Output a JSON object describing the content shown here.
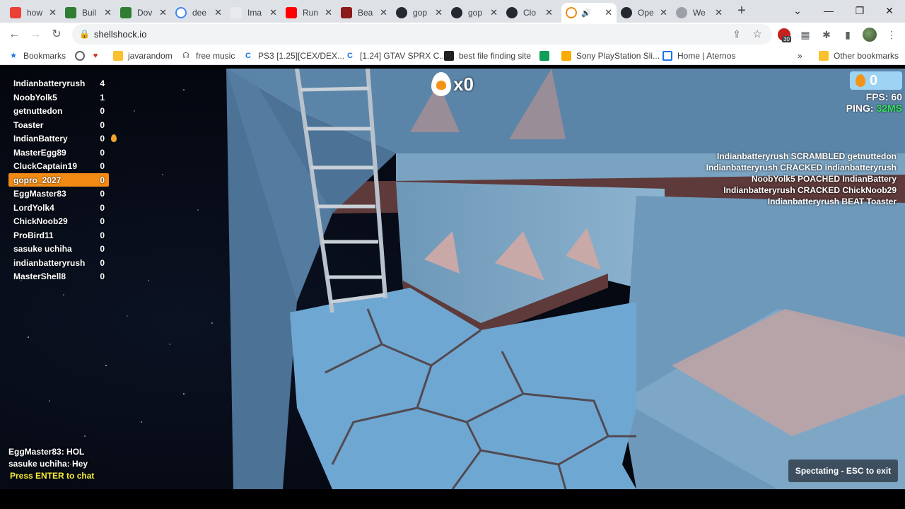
{
  "browser": {
    "tabs": [
      {
        "title": "how",
        "color": "#e94235"
      },
      {
        "title": "Buil",
        "color": "#2e7d32"
      },
      {
        "title": "Dov",
        "color": "#2e7d32"
      },
      {
        "title": "dee",
        "color": "#4285f4"
      },
      {
        "title": "Ima",
        "color": "#5f6368"
      },
      {
        "title": "Run",
        "color": "#ff0000"
      },
      {
        "title": "Bea",
        "color": "#8b1a1a"
      },
      {
        "title": "gop",
        "color": "#24292f"
      },
      {
        "title": "gop",
        "color": "#24292f"
      },
      {
        "title": "Clo",
        "color": "#24292f"
      },
      {
        "title": "",
        "color": "#f28a14"
      },
      {
        "title": "Ope",
        "color": "#24292f"
      },
      {
        "title": "We",
        "color": "#5f6368"
      }
    ],
    "url": "shellshock.io",
    "extension_badge": "30"
  },
  "bookmarks": {
    "items": [
      {
        "label": "Bookmarks",
        "icon": "star-icon"
      },
      {
        "label": "",
        "icon": "globe-icon"
      },
      {
        "label": "",
        "icon": "heart-icon"
      },
      {
        "label": "javarandom",
        "icon": "folder-icon"
      },
      {
        "label": "free music",
        "icon": "headphones-icon"
      },
      {
        "label": "PS3 [1.25][CEX/DEX...",
        "icon": "c-icon"
      },
      {
        "label": "[1.24] GTAV SPRX C...",
        "icon": "c-icon"
      },
      {
        "label": "best file finding site",
        "icon": "bus-icon"
      },
      {
        "label": "",
        "icon": "app-icon"
      },
      {
        "label": "Sony PlayStation Sli...",
        "icon": "shop-icon"
      },
      {
        "label": "Home | Aternos",
        "icon": "grid-icon"
      }
    ],
    "overflow": "»",
    "other": "Other bookmarks"
  },
  "game": {
    "scoreboard": [
      {
        "name": "Indianbatteryrush",
        "score": "4"
      },
      {
        "name": "NoobYolk5",
        "score": "1"
      },
      {
        "name": "getnuttedon",
        "score": "0"
      },
      {
        "name": "Toaster",
        "score": "0"
      },
      {
        "name": "IndianBattery",
        "score": "0"
      },
      {
        "name": "MasterEgg89",
        "score": "0"
      },
      {
        "name": "CluckCaptain19",
        "score": "0"
      },
      {
        "name": "gopro_2027",
        "score": "0"
      },
      {
        "name": "EggMaster83",
        "score": "0"
      },
      {
        "name": "LordYolk4",
        "score": "0"
      },
      {
        "name": "ChickNoob29",
        "score": "0"
      },
      {
        "name": "ProBird11",
        "score": "0"
      },
      {
        "name": "sasuke uchiha",
        "score": "0"
      },
      {
        "name": "indianbatteryrush",
        "score": "0"
      },
      {
        "name": "MasterShell8",
        "score": "0"
      }
    ],
    "kill_count": "x0",
    "eggs": "0",
    "fps_label": "FPS: 60",
    "ping_label": "PING: ",
    "ping_value": "32MS",
    "killfeed": [
      "Indianbatteryrush SCRAMBLED getnuttedon",
      "Indianbatteryrush CRACKED indianbatteryrush",
      "NoobYolk5 POACHED IndianBattery",
      "Indianbatteryrush CRACKED ChickNoob29",
      "Indianbatteryrush BEAT Toaster"
    ],
    "chat": [
      "EggMaster83: HOL",
      "sasuke uchiha: Hey"
    ],
    "chat_hint": "Press ENTER to chat",
    "spectate_label": "Spectating - ESC to exit",
    "colors": {
      "highlight": "#f28a14",
      "ping_good": "#34e25c",
      "chat_hint": "#f7f03a"
    }
  }
}
